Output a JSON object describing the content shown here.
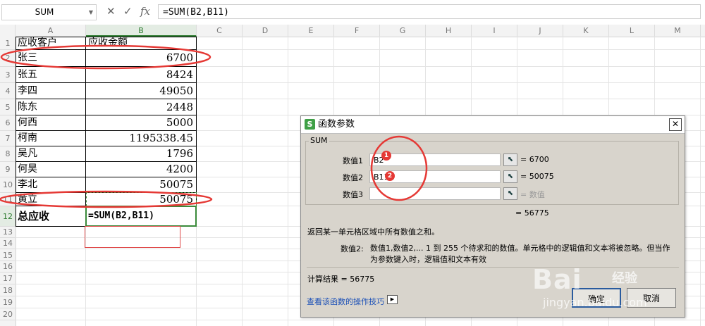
{
  "formula_bar": {
    "name_box": "SUM",
    "cancel_icon": "✕",
    "confirm_icon": "✓",
    "fx_icon": "fx",
    "formula": "=SUM(B2,B11)"
  },
  "columns": [
    "A",
    "B",
    "C",
    "D",
    "E",
    "F",
    "G",
    "H",
    "I",
    "J",
    "K",
    "L",
    "M"
  ],
  "rows": [
    "1",
    "2",
    "3",
    "4",
    "5",
    "6",
    "7",
    "8",
    "9",
    "10",
    "11",
    "12",
    "13",
    "14",
    "15",
    "16",
    "17",
    "18",
    "19",
    "20"
  ],
  "cells": {
    "a1": "应收客户",
    "b1": "应收金额",
    "a2": "张三",
    "b2": "6700",
    "a3": "张五",
    "b3": "8424",
    "a4": "李四",
    "b4": "49050",
    "a5": "陈东",
    "b5": "2448",
    "a6": "何西",
    "b6": "5000",
    "a7": "柯南",
    "b7": "1195338.45",
    "a8": "吴凡",
    "b8": "1796",
    "a9": "何昊",
    "b9": "4200",
    "a10": "李北",
    "b10": "50075",
    "a11": "黄立",
    "b11": "50075",
    "a12": "总应收",
    "b12": "=SUM(B2,B11)"
  },
  "dialog": {
    "title": "函数参数",
    "close_icon": "✕",
    "function_name": "SUM",
    "args": [
      {
        "label": "数值1",
        "value": "B2",
        "result": "= 6700",
        "badge": "1"
      },
      {
        "label": "数值2",
        "value": "B11",
        "result": "= 50075",
        "badge": "2"
      },
      {
        "label": "数值3",
        "value": "",
        "result": "= 数值"
      }
    ],
    "total": "= 56775",
    "description": "返回某一单元格区域中所有数值之和。",
    "param_name": "数值2:",
    "param_description": "数值1,数值2,... 1 到 255 个待求和的数值。单元格中的逻辑值和文本将被忽略。但当作为参数键入时，逻辑值和文本有效",
    "calc_result": "计算结果 = 56775",
    "help_link": "查看该函数的操作技巧",
    "ok_label": "确定",
    "cancel_label": "取消"
  },
  "watermark": {
    "brand": "Bai",
    "brand_suffix": "经验",
    "url": "jingyan.baidu.com"
  },
  "colors": {
    "accent_green": "#2f7d32",
    "annotation_red": "#e53935",
    "dialog_bg": "#d8d4cc"
  }
}
